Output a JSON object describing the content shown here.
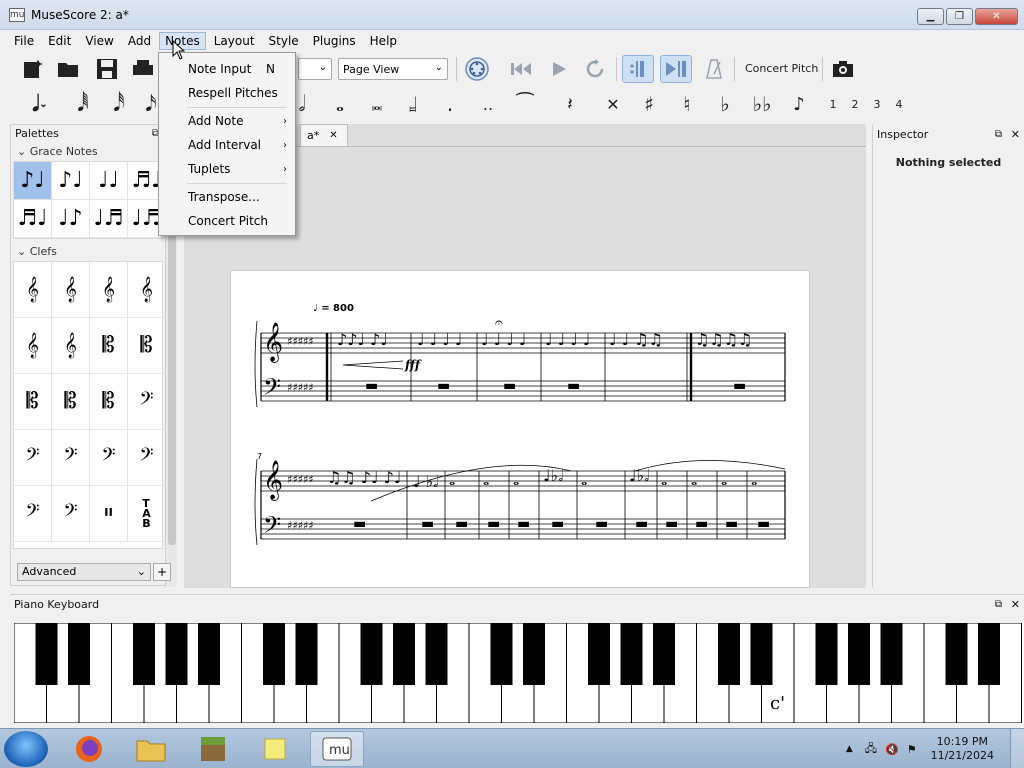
{
  "window": {
    "title": "MuseScore 2: a*",
    "app_icon": "mu"
  },
  "menubar": [
    "File",
    "Edit",
    "View",
    "Add",
    "Notes",
    "Layout",
    "Style",
    "Plugins",
    "Help"
  ],
  "toolbar": {
    "view_mode": "Page View",
    "zoom_value": "",
    "concert_pitch": "Concert Pitch"
  },
  "voices": [
    "1",
    "2",
    "3",
    "4"
  ],
  "notes_menu": {
    "items": [
      {
        "label": "Note Input",
        "shortcut": "N"
      },
      {
        "label": "Respell Pitches"
      },
      {
        "label": "Add Note",
        "submenu": true
      },
      {
        "label": "Add Interval",
        "submenu": true
      },
      {
        "label": "Tuplets",
        "submenu": true
      },
      {
        "label": "Transpose..."
      },
      {
        "label": "Concert Pitch"
      }
    ]
  },
  "palettes": {
    "title": "Palettes",
    "sections": [
      "Grace Notes",
      "Clefs"
    ],
    "selector": "Advanced",
    "add_label": "+"
  },
  "score": {
    "tab_label": "a*",
    "tempo": "♩ = 800",
    "dynamic": "fff",
    "measure_number": "7"
  },
  "inspector": {
    "title": "Inspector",
    "empty_text": "Nothing selected"
  },
  "piano": {
    "title": "Piano Keyboard",
    "marker": "c'"
  },
  "taskbar": {
    "time": "10:19 PM",
    "date": "11/21/2024"
  }
}
